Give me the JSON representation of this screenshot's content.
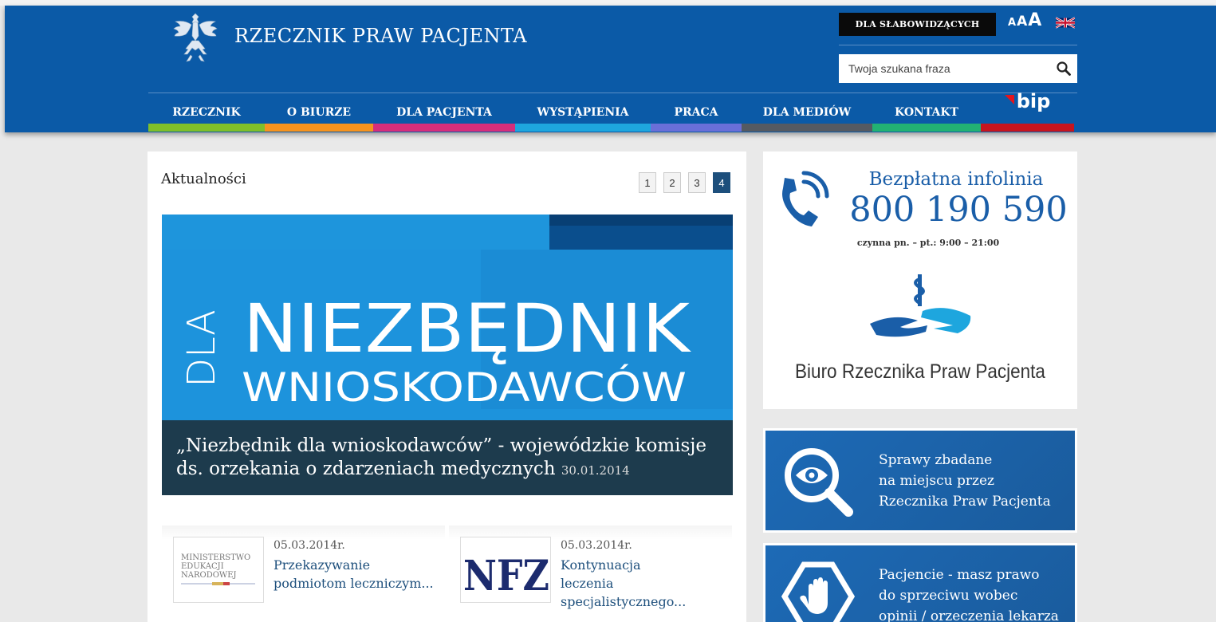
{
  "header": {
    "site_title": "RZECZNIK PRAW PACJENTA",
    "low_vision_label": "DLA SŁABOWIDZĄCYCH",
    "font_small": "A",
    "font_medium": "A",
    "font_large": "A",
    "search_placeholder": "Twoja szukana fraza"
  },
  "nav": {
    "items": [
      {
        "label": "RZECZNIK",
        "color": "#7fbf2a"
      },
      {
        "label": "O BIURZE",
        "color": "#f6931f"
      },
      {
        "label": "DLA PACJENTA",
        "color": "#d62e7b"
      },
      {
        "label": "WYSTĄPIENIA",
        "color": "#1ea6de"
      },
      {
        "label": "PRACA",
        "color": "#6a6fd8"
      },
      {
        "label": "DLA MEDIÓW",
        "color": "#555a62"
      },
      {
        "label": "KONTAKT",
        "color": "#22b273"
      },
      {
        "label": "bip",
        "color": "#c6151e"
      }
    ]
  },
  "news": {
    "section_title": "Aktualności",
    "pages": [
      "1",
      "2",
      "3",
      "4"
    ],
    "active_page": "4",
    "hero": {
      "image_line1": "NIEZBĘDNIK",
      "image_line2": "WNIOSKODAWCÓW",
      "image_side": "DLA",
      "title": "„Niezbędnik dla wnioskodawców” - wojewódzkie komisje ds. orzekania o zdarzeniach medycznych",
      "date": "30.01.2014"
    },
    "cards": [
      {
        "date": "05.03.2014r.",
        "title": "Przekazywanie podmiotom leczniczym...",
        "thumb_line1": "MINISTERSTWO",
        "thumb_line2": "EDUKACJI",
        "thumb_line3": "NARODOWEJ"
      },
      {
        "date": "05.03.2014r.",
        "title": "Kontynuacja leczenia specjalistycznego...",
        "thumb_text": "NFZ"
      }
    ]
  },
  "sidebar": {
    "infoline_title": "Bezpłatna infolinia",
    "infoline_number": "800 190 590",
    "infoline_hours": "czynna pn. – pt.: 9:00 – 21:00",
    "office_name": "Biuro Rzecznika Praw Pacjenta",
    "promo1": {
      "line1": "Sprawy zbadane",
      "line2": "na miejscu przez",
      "line3": "Rzecznika Praw Pacjenta"
    },
    "promo2": {
      "line1": "Pacjencie - masz prawo",
      "line2": "do sprzeciwu wobec",
      "line3": "opinii / orzeczenia lekarza"
    }
  },
  "colors": {
    "header_blue": "#0b5aa7",
    "accent_blue": "#1a5ea8",
    "hero_blue": "#1e8fd6"
  },
  "icons": [
    "eagle-emblem-icon",
    "uk-flag-icon",
    "search-icon",
    "phone-icon",
    "brpp-hands-logo-icon",
    "magnifier-eye-icon",
    "stop-hand-icon"
  ]
}
